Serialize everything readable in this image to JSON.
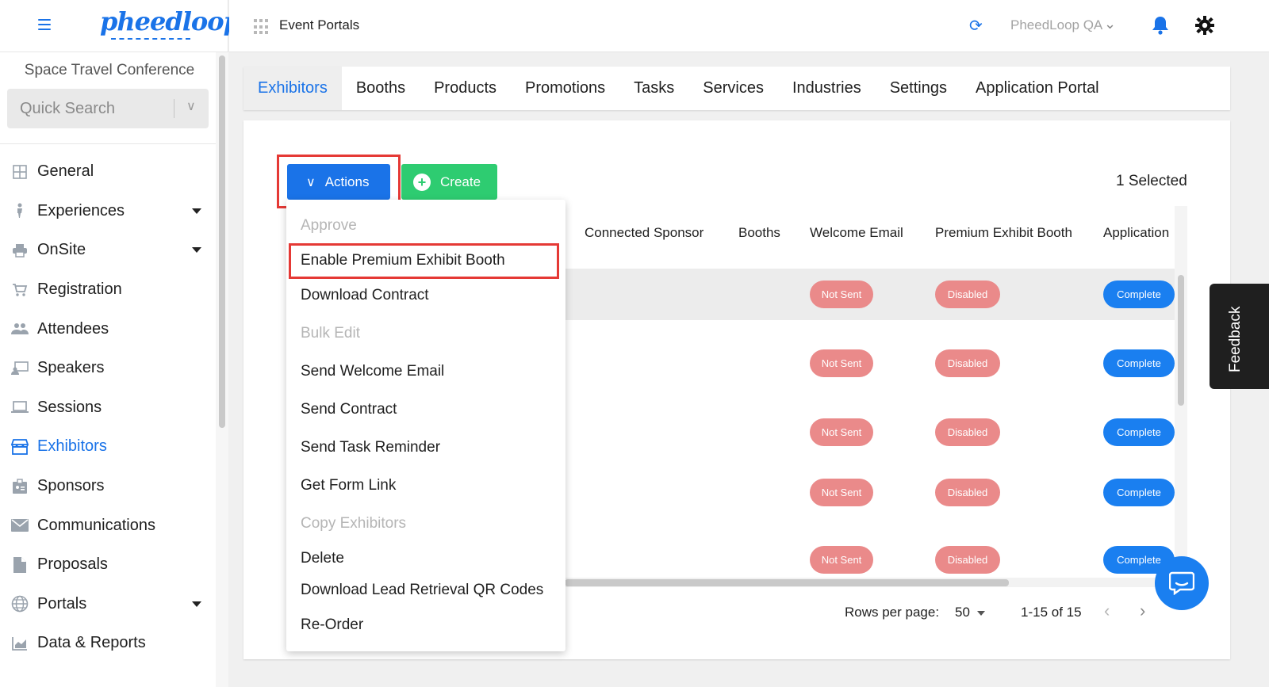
{
  "sidebar": {
    "event_name": "Space Travel Conference",
    "search_placeholder": "Quick Search",
    "items": [
      {
        "label": "General",
        "icon": "grid-icon"
      },
      {
        "label": "Experiences",
        "icon": "person-icon"
      },
      {
        "label": "OnSite",
        "icon": "printer-icon"
      },
      {
        "label": "Registration",
        "icon": "cart-icon"
      },
      {
        "label": "Attendees",
        "icon": "people-icon"
      },
      {
        "label": "Speakers",
        "icon": "presenter-icon"
      },
      {
        "label": "Sessions",
        "icon": "laptop-icon"
      },
      {
        "label": "Exhibitors",
        "icon": "storefront-icon"
      },
      {
        "label": "Sponsors",
        "icon": "badge-icon"
      },
      {
        "label": "Communications",
        "icon": "mail-icon"
      },
      {
        "label": "Proposals",
        "icon": "document-icon"
      },
      {
        "label": "Portals",
        "icon": "globe-icon"
      },
      {
        "label": "Data & Reports",
        "icon": "chart-icon"
      }
    ]
  },
  "header": {
    "portal_title": "Event Portals",
    "org_name": "PheedLoop QA",
    "logo_text": "pheedloop"
  },
  "tabs": [
    "Exhibitors",
    "Booths",
    "Products",
    "Promotions",
    "Tasks",
    "Services",
    "Industries",
    "Settings",
    "Application Portal"
  ],
  "toolbar": {
    "actions_label": "Actions",
    "create_label": "Create",
    "selected_text": "1 Selected"
  },
  "table": {
    "columns": [
      "Connected Sponsor",
      "Booths",
      "Welcome Email",
      "Premium Exhibit Booth",
      "Application"
    ],
    "rows": [
      {
        "welcome_email": "Not Sent",
        "premium": "Disabled",
        "application": "Complete"
      },
      {
        "welcome_email": "Not Sent",
        "premium": "Disabled",
        "application": "Complete"
      },
      {
        "welcome_email": "Not Sent",
        "premium": "Disabled",
        "application": "Complete"
      },
      {
        "welcome_email": "Not Sent",
        "premium": "Disabled",
        "application": "Complete"
      },
      {
        "welcome_email": "Not Sent",
        "premium": "Disabled",
        "application": "Complete"
      }
    ]
  },
  "pagination": {
    "rows_label": "Rows per page:",
    "rows_value": "50",
    "range": "1-15 of 15"
  },
  "menu": {
    "items": [
      {
        "label": "Approve",
        "disabled": true
      },
      {
        "label": "Enable Premium Exhibit Booth",
        "disabled": false
      },
      {
        "label": "Download Contract",
        "disabled": false
      },
      {
        "label": "Bulk Edit",
        "disabled": true
      },
      {
        "label": "Send Welcome Email",
        "disabled": false
      },
      {
        "label": "Send Contract",
        "disabled": false
      },
      {
        "label": "Send Task Reminder",
        "disabled": false
      },
      {
        "label": "Get Form Link",
        "disabled": false
      },
      {
        "label": "Copy Exhibitors",
        "disabled": true
      },
      {
        "label": "Delete",
        "disabled": false
      },
      {
        "label": "Download Lead Retrieval QR Codes",
        "disabled": false
      },
      {
        "label": "Re-Order",
        "disabled": false
      }
    ]
  },
  "feedback_label": "Feedback",
  "colors": {
    "primary": "#1a73e8",
    "create": "#2ecc71",
    "status_not_sent": "#ea8a8a",
    "status_complete": "#1a7ff0",
    "highlight": "#e53935"
  }
}
